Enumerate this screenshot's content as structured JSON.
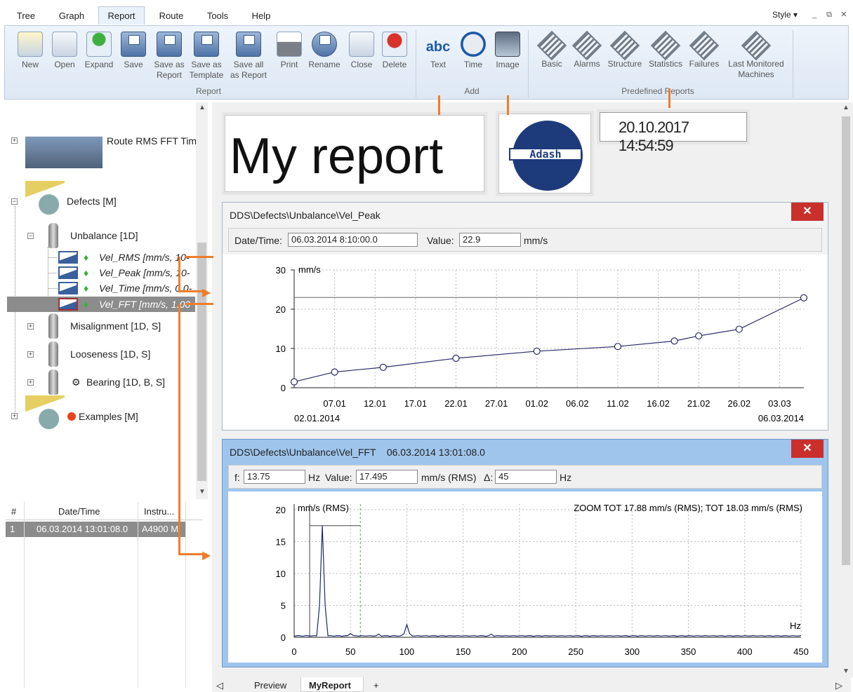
{
  "menu": {
    "tabs": [
      "Tree",
      "Graph",
      "Report",
      "Route",
      "Tools",
      "Help"
    ],
    "active": "Report",
    "style": "Style",
    "window_controls": [
      "_",
      "⧉",
      "✕"
    ]
  },
  "ribbon": {
    "report_buttons": [
      {
        "label": "New"
      },
      {
        "label": "Open"
      },
      {
        "label": "Expand"
      },
      {
        "label": "Save"
      },
      {
        "label": "Save as\nReport"
      },
      {
        "label": "Save as\nTemplate"
      },
      {
        "label": "Save all\nas Report"
      },
      {
        "label": "Print"
      },
      {
        "label": "Rename"
      },
      {
        "label": "Close"
      },
      {
        "label": "Delete"
      }
    ],
    "report_group": "Report",
    "add_buttons": [
      {
        "label": "Text"
      },
      {
        "label": "Time"
      },
      {
        "label": "Image"
      }
    ],
    "add_group": "Add",
    "predefined_buttons": [
      {
        "label": "Basic"
      },
      {
        "label": "Alarms"
      },
      {
        "label": "Structure"
      },
      {
        "label": "Statistics"
      },
      {
        "label": "Failures"
      },
      {
        "label": "Last Monitored\nMachines"
      }
    ],
    "predefined_group": "Predefined Reports"
  },
  "tree": {
    "route": "Route RMS FFT Tim",
    "defects": "Defects [M]",
    "unbalance": "Unbalance [1D]",
    "items": [
      "Vel_RMS [mm/s, 10-",
      "Vel_Peak [mm/s, 10-",
      "Vel_Time [mm/s, 0.0-",
      "Vel_FFT [mm/s, 1.00"
    ],
    "misalignment": "Misalignment [1D, S]",
    "looseness": "Looseness [1D, S]",
    "bearing": "Bearing [1D, B, S]",
    "examples": "Examples [M]"
  },
  "grid": {
    "headers": [
      "#",
      "Date/Time",
      "Instru..."
    ],
    "rows": [
      [
        "1",
        "06.03.2014 13:01:08.0",
        "A4900 M"
      ]
    ]
  },
  "report": {
    "title": "My report",
    "logo_text": "Adash",
    "timestamp": "20.10.2017 14:54:59",
    "peak": {
      "title": "DDS\\Defects\\Unbalance\\Vel_Peak",
      "datetime_label": "Date/Time:",
      "datetime": "06.03.2014 8:10:00.0",
      "value_label": "Value:",
      "value": "22.9",
      "unit": "mm/s"
    },
    "fft": {
      "title": "DDS\\Defects\\Unbalance\\Vel_FFT    06.03.2014 13:01:08.0",
      "f_label": "f:",
      "f": "13.75",
      "hz1": "Hz",
      "value_label": "Value:",
      "value": "17.495",
      "unit": "mm/s (RMS)",
      "delta_label": "Δ:",
      "delta": "45",
      "hz2": "Hz"
    },
    "close": "✕"
  },
  "bottom_tabs": {
    "left_arrow": "◁",
    "tabs": [
      "Preview",
      "MyReport",
      "+"
    ],
    "right_arrow": "▷"
  },
  "chart_data": [
    {
      "type": "line",
      "ylabel": "mm/s",
      "ylim": [
        0,
        30
      ],
      "yticks": [
        "0",
        "10",
        "20",
        "30"
      ],
      "xticks": [
        "07.01",
        "12.01",
        "17.01",
        "22.01",
        "27.01",
        "01.02",
        "06.02",
        "11.02",
        "16.02",
        "21.02",
        "26.02",
        "03.03"
      ],
      "x_start": "02.01.2014",
      "x_end": "06.03.2014",
      "reference_line": 23,
      "points": [
        [
          "02.01",
          1.5
        ],
        [
          "07.01",
          4
        ],
        [
          "13.01",
          5.2
        ],
        [
          "22.01",
          7.5
        ],
        [
          "01.02",
          9.3
        ],
        [
          "11.02",
          10.5
        ],
        [
          "18.02",
          11.9
        ],
        [
          "21.02",
          13.2
        ],
        [
          "26.02",
          14.9
        ],
        [
          "06.03",
          22.9
        ]
      ]
    },
    {
      "type": "line",
      "ylabel": "mm/s (RMS)",
      "xlabel": "Hz",
      "ylim": [
        0,
        20
      ],
      "xlim": [
        0,
        450
      ],
      "yticks": [
        "0",
        "5",
        "10",
        "15",
        "20"
      ],
      "xticks": [
        "0",
        "50",
        "100",
        "150",
        "200",
        "250",
        "300",
        "350",
        "400",
        "450"
      ],
      "annotation": "ZOOM TOT 17.88 mm/s (RMS); TOT 18.03 mm/s (RMS)",
      "peaks": [
        [
          25,
          17.5
        ],
        [
          100,
          2
        ],
        [
          50,
          0.6
        ],
        [
          75,
          0.5
        ],
        [
          175,
          0.5
        ]
      ],
      "cursor_hz": 58.75,
      "band_start_hz": 13.75
    }
  ]
}
